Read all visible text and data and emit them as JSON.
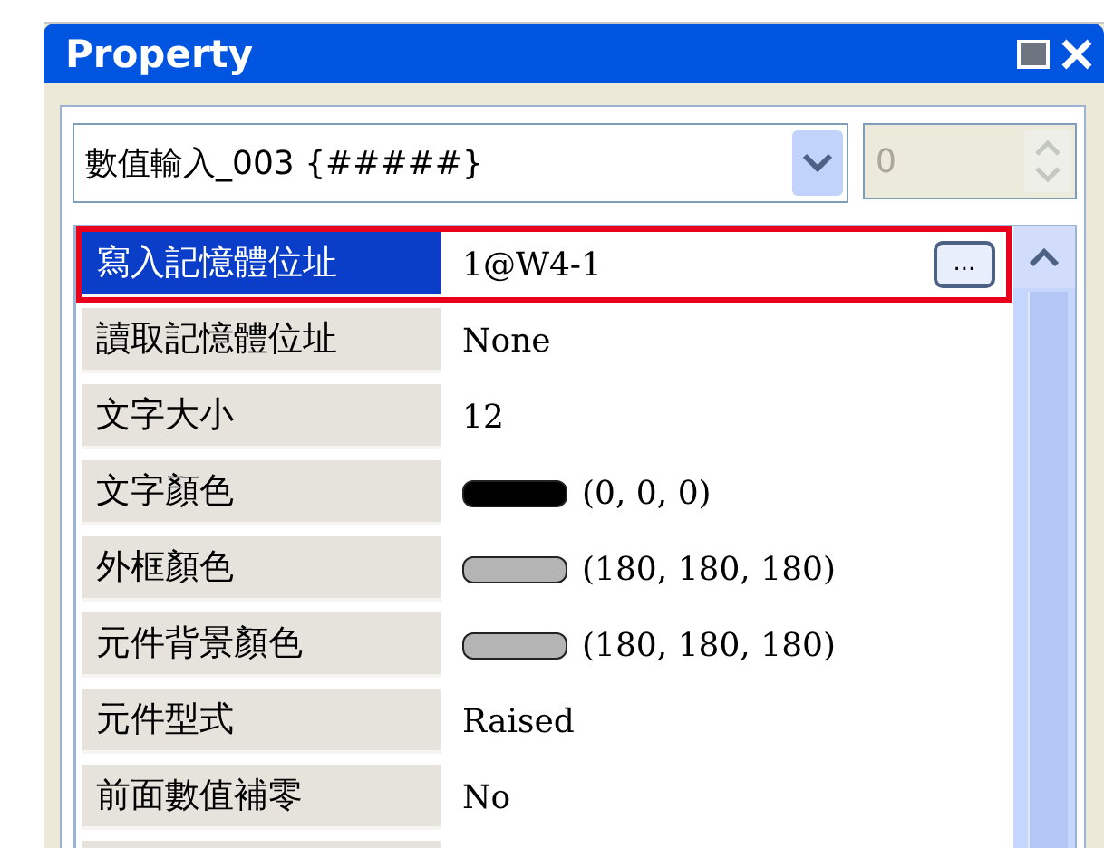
{
  "window": {
    "title": "Property"
  },
  "object_selector": {
    "value": "數值輸入_003 {#####}"
  },
  "spin_field": {
    "value": "0",
    "disabled": true
  },
  "properties": [
    {
      "label": "寫入記憶體位址",
      "value": "1@W4-1",
      "kind": "text",
      "selected": true,
      "button": "..."
    },
    {
      "label": "讀取記憶體位址",
      "value": "None",
      "kind": "text",
      "selected": false
    },
    {
      "label": "文字大小",
      "value": "12",
      "kind": "text",
      "selected": false
    },
    {
      "label": "文字顏色",
      "value": "(0, 0, 0)",
      "kind": "color",
      "color": "#000000",
      "selected": false
    },
    {
      "label": "外框顏色",
      "value": "(180, 180, 180)",
      "kind": "color",
      "color": "#b4b4b4",
      "selected": false
    },
    {
      "label": "元件背景顏色",
      "value": "(180, 180, 180)",
      "kind": "color",
      "color": "#b4b4b4",
      "selected": false
    },
    {
      "label": "元件型式",
      "value": "Raised",
      "kind": "text",
      "selected": false
    },
    {
      "label": "前面數值補零",
      "value": "No",
      "kind": "text",
      "selected": false
    }
  ]
}
